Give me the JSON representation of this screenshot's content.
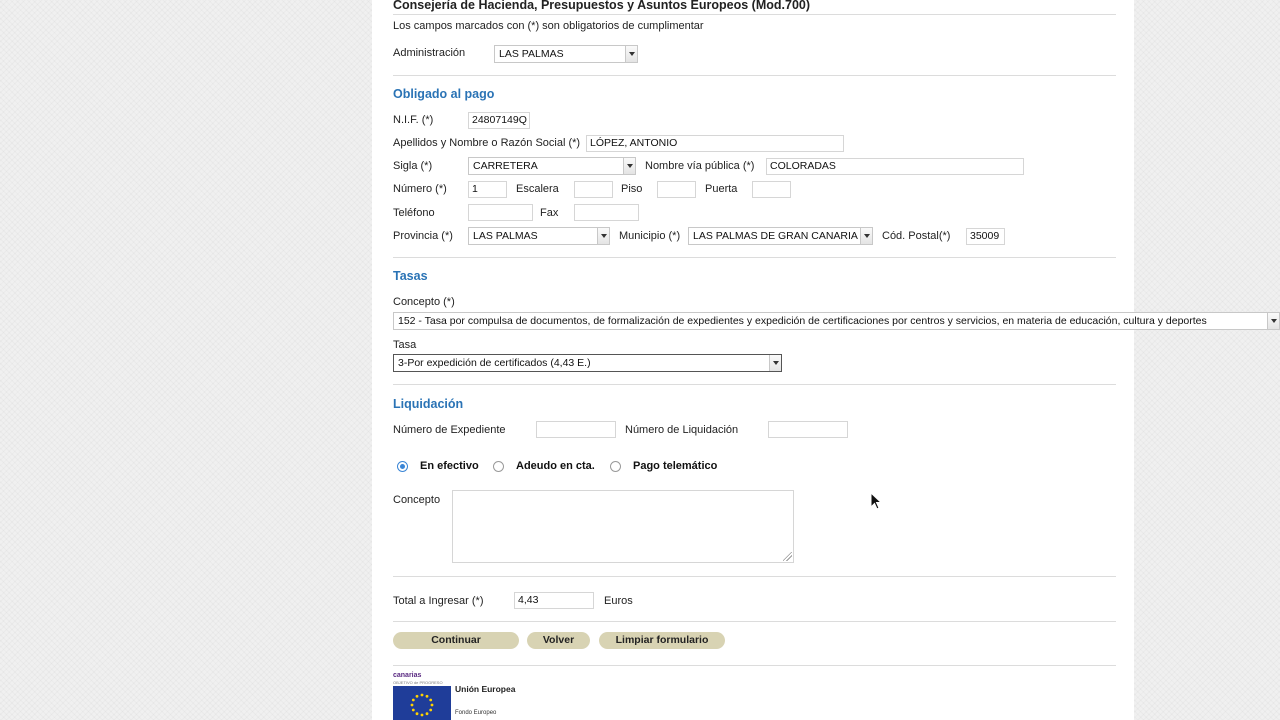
{
  "header": {
    "title": "Consejería de Hacienda, Presupuestos y Asuntos Europeos (Mod.700)",
    "required_note": "Los campos marcados con (*) son obligatorios de cumplimentar"
  },
  "administracion": {
    "label": "Administración",
    "value": "LAS PALMAS"
  },
  "obligado": {
    "heading": "Obligado al pago",
    "nif_label": "N.I.F. (*)",
    "nif_value": "24807149Q",
    "nombre_label": "Apellidos y Nombre o Razón Social (*)",
    "nombre_value": "LÓPEZ, ANTONIO",
    "sigla_label": "Sigla (*)",
    "sigla_value": "CARRETERA",
    "via_label": "Nombre vía pública (*)",
    "via_value": "COLORADAS",
    "numero_label": "Número (*)",
    "numero_value": "1",
    "escalera_label": "Escalera",
    "escalera_value": "",
    "piso_label": "Piso",
    "piso_value": "",
    "puerta_label": "Puerta",
    "puerta_value": "",
    "telefono_label": "Teléfono",
    "telefono_value": "",
    "fax_label": "Fax",
    "fax_value": "",
    "provincia_label": "Provincia (*)",
    "provincia_value": "LAS PALMAS",
    "municipio_label": "Municipio (*)",
    "municipio_value": "LAS PALMAS DE GRAN CANARIA",
    "cp_label": "Cód. Postal(*)",
    "cp_value": "35009"
  },
  "tasas": {
    "heading": "Tasas",
    "concepto_label": "Concepto (*)",
    "concepto_value": "152 - Tasa por compulsa de documentos, de formalización de expedientes y expedición de certificaciones por centros y servicios, en materia de educación, cultura y deportes",
    "tasa_label": "Tasa",
    "tasa_value": "3-Por expedición de certificados (4,43 E.)"
  },
  "liquidacion": {
    "heading": "Liquidación",
    "expediente_label": "Número de Expediente",
    "expediente_value": "",
    "liquidacion_label": "Número de Liquidación",
    "liquidacion_value": "",
    "radio_efectivo": "En efectivo",
    "radio_adeudo": "Adeudo en cta.",
    "radio_telematico": "Pago telemático",
    "selected_payment": "En efectivo",
    "concepto_label": "Concepto",
    "concepto_value": ""
  },
  "total": {
    "label": "Total a Ingresar (*)",
    "value": "4,43",
    "unit": "Euros"
  },
  "buttons": {
    "continuar": "Continuar",
    "volver": "Volver",
    "limpiar": "Limpiar formulario"
  },
  "footer": {
    "brand": "canarias",
    "brand_sub": "OBJETIVO de PROGRESO",
    "eu_title": "Unión Europea",
    "eu_fund": "Fondo Europeo"
  },
  "icons": {
    "cursor": "mouse-pointer-icon",
    "dropdown": "chevron-down-icon"
  },
  "colors": {
    "section_heading": "#2a73b5",
    "button_bg": "#d8d3b3",
    "radio_selected": "#3b86d6"
  }
}
